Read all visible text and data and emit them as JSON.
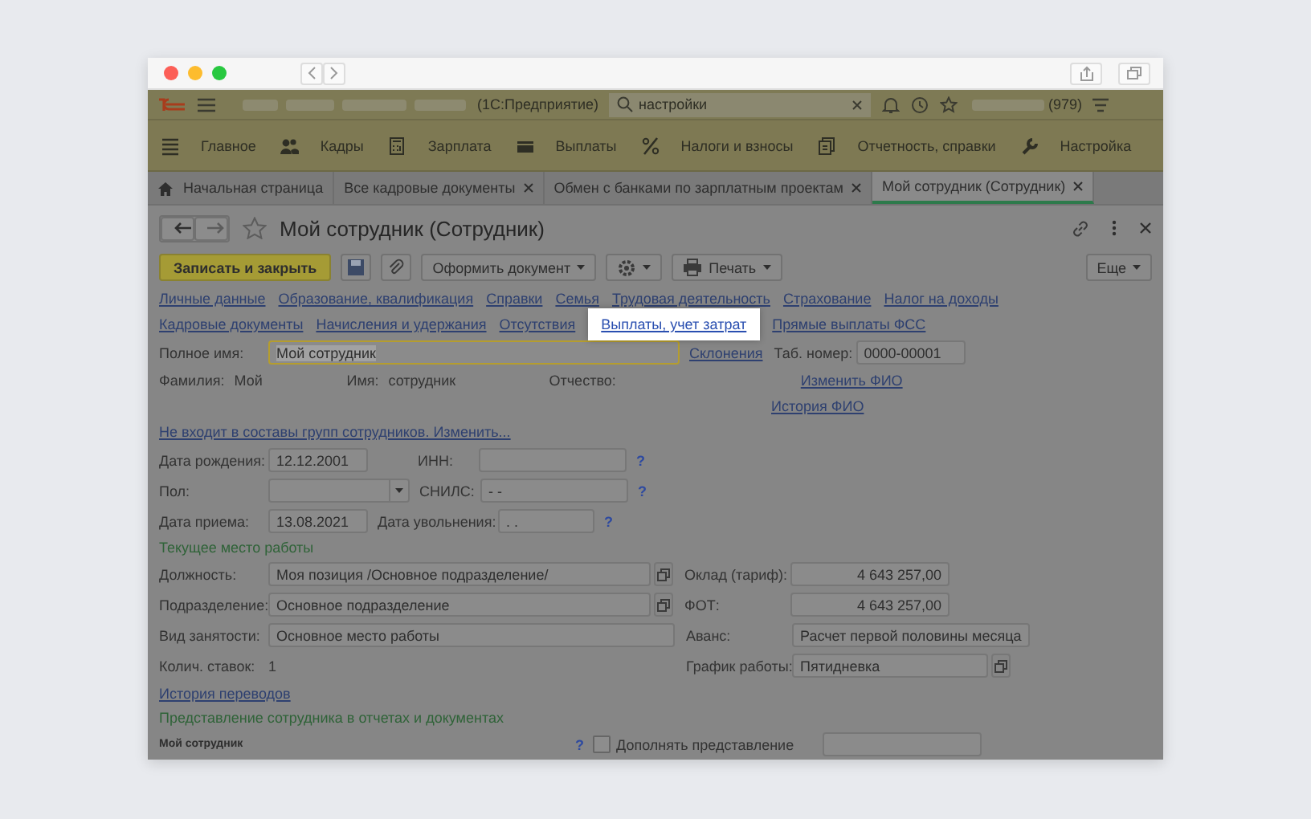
{
  "header": {
    "product": "(1С:Предприятие)",
    "search_value": "настройки",
    "user_count": "(979)"
  },
  "sections": [
    {
      "label": "Главное",
      "kind": "menu"
    },
    {
      "label": "Кадры",
      "kind": "people"
    },
    {
      "label": "Зарплата",
      "kind": "calculator"
    },
    {
      "label": "Выплаты",
      "kind": "card"
    },
    {
      "label": "Налоги и взносы",
      "kind": "percent"
    },
    {
      "label": "Отчетность, справки",
      "kind": "documents"
    },
    {
      "label": "Настройка",
      "kind": "wrench"
    }
  ],
  "tabs": [
    {
      "label": "Начальная страница",
      "kind": "home",
      "selected": false
    },
    {
      "label": "Все кадровые документы",
      "kind": "closable",
      "selected": false
    },
    {
      "label": "Обмен с банками по зарплатным проектам",
      "kind": "closable",
      "selected": false
    },
    {
      "label": "Мой сотрудник (Сотрудник)",
      "kind": "closable",
      "selected": true
    }
  ],
  "form": {
    "title": "Мой сотрудник (Сотрудник)",
    "toolbar": {
      "save_close": "Записать и закрыть",
      "format_doc": "Оформить документ",
      "print": "Печать",
      "more": "Еще"
    },
    "nav_links": [
      [
        {
          "label": "Личные данные",
          "highlighted": false
        },
        {
          "label": "Образование, квалификация",
          "highlighted": false
        },
        {
          "label": "Справки",
          "highlighted": false
        },
        {
          "label": "Семья",
          "highlighted": false
        },
        {
          "label": "Трудовая деятельность",
          "highlighted": false
        },
        {
          "label": "Страхование",
          "highlighted": false
        },
        {
          "label": "Налог на доходы",
          "highlighted": false
        }
      ],
      [
        {
          "label": "Кадровые документы",
          "highlighted": false
        },
        {
          "label": "Начисления и удержания",
          "highlighted": false
        },
        {
          "label": "Отсутствия",
          "highlighted": false
        },
        {
          "label": "Выплаты, учет затрат",
          "highlighted": true
        },
        {
          "label": "Прямые выплаты ФСС",
          "highlighted": false
        }
      ]
    ],
    "full_name": {
      "label": "Полное имя:",
      "value": "Мой сотрудник",
      "declension": "Склонения"
    },
    "tab_number": {
      "label": "Таб. номер:",
      "value": "0000-00001"
    },
    "surname": {
      "label": "Фамилия:",
      "value": "Мой"
    },
    "first_name": {
      "label": "Имя:",
      "value": "сотрудник"
    },
    "patronymic": {
      "label": "Отчество:"
    },
    "change_name": "Изменить ФИО",
    "name_history": "История ФИО",
    "groups_link": "Не входит в составы групп сотрудников. Изменить...",
    "birth_date": {
      "label": "Дата рождения:",
      "value": "12.12.2001"
    },
    "inn": {
      "label": "ИНН:",
      "help": "?"
    },
    "gender": {
      "label": "Пол:"
    },
    "snils": {
      "label": "СНИЛС:",
      "value": "-  -",
      "help": "?"
    },
    "hire_date": {
      "label": "Дата приема:",
      "value": "13.08.2021"
    },
    "dismissal_date": {
      "label": "Дата увольнения:",
      "value": ". .",
      "help": "?"
    },
    "workplace_heading": "Текущее место работы",
    "position": {
      "label": "Должность:",
      "value": "Моя позиция /Основное подразделение/"
    },
    "salary": {
      "label": "Оклад (тариф):",
      "value": "4 643 257,00"
    },
    "department": {
      "label": "Подразделение:",
      "value": "Основное подразделение"
    },
    "payroll": {
      "label": "ФОТ:",
      "value": "4 643 257,00"
    },
    "employment_type": {
      "label": "Вид занятости:",
      "value": "Основное место работы"
    },
    "advance": {
      "label": "Аванс:",
      "value": "Расчет первой половины месяца"
    },
    "rates": {
      "label": "Колич. ставок:",
      "value": "1"
    },
    "schedule": {
      "label": "График работы:",
      "value": "Пятидневка"
    },
    "transfer_history": "История переводов",
    "representation_heading": "Представление сотрудника в отчетах и документах",
    "representation": {
      "name": "Мой сотрудник",
      "help": "?",
      "supplement": {
        "label": "Дополнять представление",
        "checked": false
      }
    }
  }
}
